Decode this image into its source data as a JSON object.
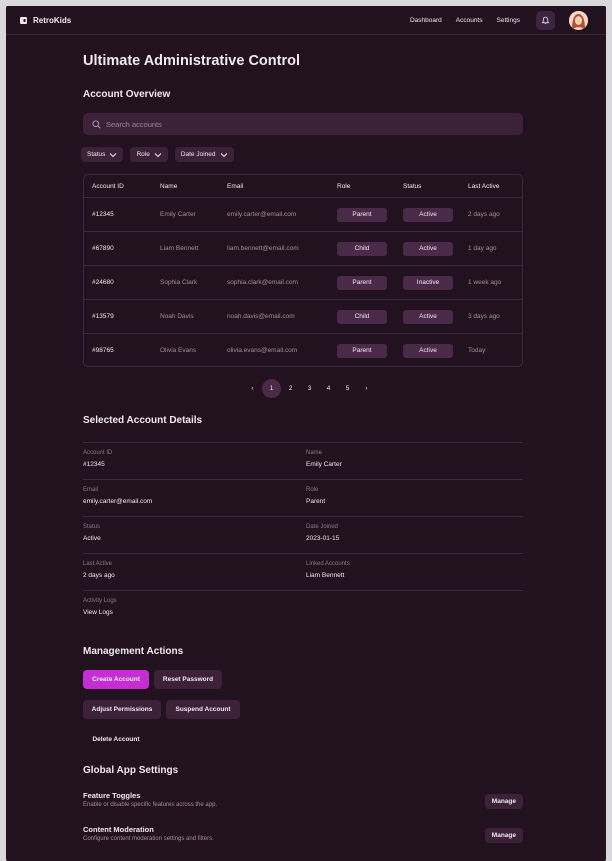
{
  "app": {
    "name": "RetroKids"
  },
  "nav": {
    "dashboard": "Dashboard",
    "accounts": "Accounts",
    "settings": "Settings"
  },
  "page": {
    "title": "Ultimate Administrative Control"
  },
  "overview": {
    "heading": "Account Overview",
    "search_placeholder": "Search accounts",
    "filters": [
      "Status",
      "Role",
      "Date Joined"
    ],
    "columns": [
      "Account ID",
      "Name",
      "Email",
      "Role",
      "Status",
      "Last Active"
    ],
    "rows": [
      {
        "id": "#12345",
        "name": "Emily Carter",
        "email": "emily.carter@email.com",
        "role": "Parent",
        "status": "Active",
        "last_active": "2 days ago"
      },
      {
        "id": "#67890",
        "name": "Liam Bennett",
        "email": "liam.bennett@email.com",
        "role": "Child",
        "status": "Active",
        "last_active": "1 day ago"
      },
      {
        "id": "#24680",
        "name": "Sophia Clark",
        "email": "sophia.clark@email.com",
        "role": "Parent",
        "status": "Inactive",
        "last_active": "1 week ago"
      },
      {
        "id": "#13579",
        "name": "Noah Davis",
        "email": "noah.davis@email.com",
        "role": "Child",
        "status": "Active",
        "last_active": "3 days ago"
      },
      {
        "id": "#98765",
        "name": "Olivia Evans",
        "email": "olivia.evans@email.com",
        "role": "Parent",
        "status": "Active",
        "last_active": "Today"
      }
    ]
  },
  "pagination": {
    "prev": "‹",
    "next": "›",
    "pages": [
      "1",
      "2",
      "3",
      "4",
      "5"
    ],
    "current": "1"
  },
  "details": {
    "heading": "Selected Account Details",
    "fields": [
      {
        "label": "Account ID",
        "value": "#12345"
      },
      {
        "label": "Name",
        "value": "Emily Carter"
      },
      {
        "label": "Email",
        "value": "emily.carter@email.com"
      },
      {
        "label": "Role",
        "value": "Parent"
      },
      {
        "label": "Status",
        "value": "Active"
      },
      {
        "label": "Date Joined",
        "value": "2023-01-15"
      },
      {
        "label": "Last Active",
        "value": "2 days ago"
      },
      {
        "label": "Linked Accounts",
        "value": "Liam Bennett"
      },
      {
        "label": "Activity Logs",
        "value": "View Logs"
      }
    ]
  },
  "actions": {
    "heading": "Management Actions",
    "create": "Create Account",
    "reset": "Reset Password",
    "adjust": "Adjust Permissions",
    "suspend": "Suspend Account",
    "delete": "Delete Account"
  },
  "global_settings": {
    "heading": "Global App Settings",
    "items": [
      {
        "title": "Feature Toggles",
        "desc": "Enable or disable specific features across the app.",
        "button": "Manage"
      },
      {
        "title": "Content Moderation",
        "desc": "Configure content moderation settings and filters.",
        "button": "Manage"
      }
    ]
  },
  "colors": {
    "background": "#22111f",
    "surface": "#3c2139",
    "pill": "#4a2a48",
    "accent": "#c42ed3"
  },
  "icons": [
    "logo-icon",
    "bell-icon",
    "avatar",
    "search-icon",
    "chevron-down-icon"
  ]
}
